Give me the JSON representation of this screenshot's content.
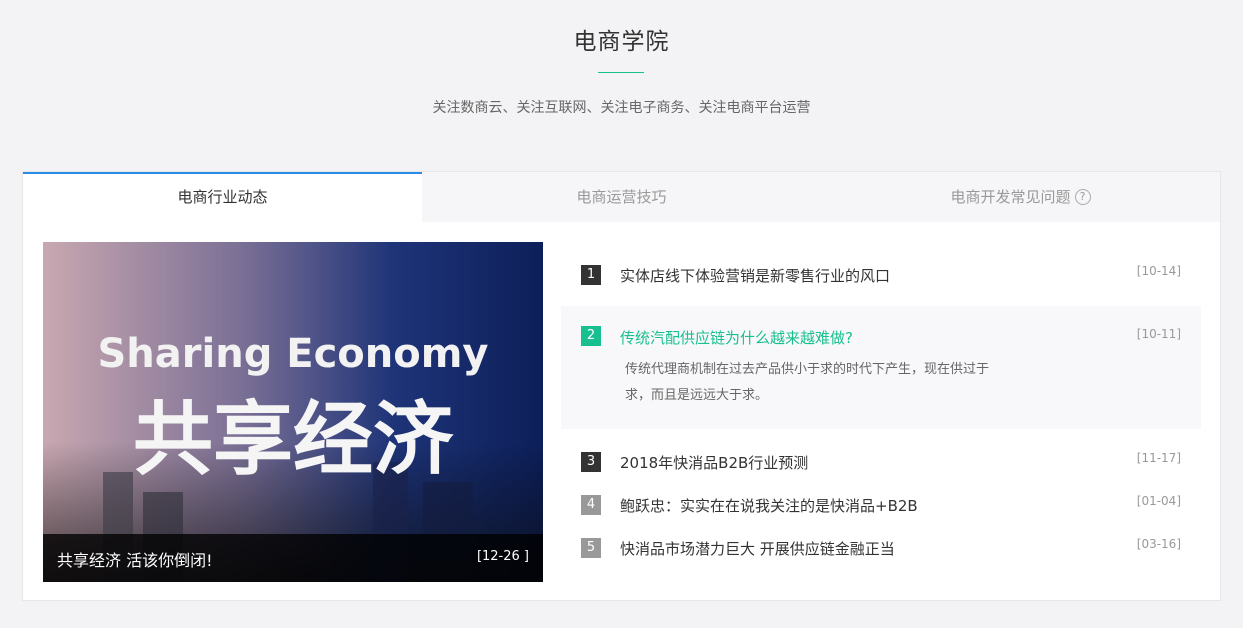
{
  "header": {
    "title": "电商学院",
    "subtitle": "关注数商云、关注互联网、关注电子商务、关注电商平台运营"
  },
  "tabs": [
    {
      "label": "电商行业动态",
      "active": true
    },
    {
      "label": "电商运营技巧",
      "active": false
    },
    {
      "label": "电商开发常见问题",
      "active": false,
      "help_icon": "?"
    }
  ],
  "feature": {
    "image_text_en": "Sharing Economy",
    "image_text_cn": "共享经济",
    "caption": "共享经济 活该你倒闭!",
    "date": "[12-26 ]"
  },
  "news": [
    {
      "num": "1",
      "title": "实体店线下体验营销是新零售行业的风口",
      "date": "[10-14]"
    },
    {
      "num": "2",
      "title": "传统汽配供应链为什么越来越难做?",
      "date": "[10-11]",
      "desc_line1": "传统代理商机制在过去产品供小于求的时代下产生，现在供过于",
      "desc_line2": "求，而且是远远大于求。"
    },
    {
      "num": "3",
      "title": "2018年快消品B2B行业预测",
      "date": "[11-17]"
    },
    {
      "num": "4",
      "title": "鲍跃忠：实实在在说我关注的是快消品+B2B",
      "date": "[01-04]"
    },
    {
      "num": "5",
      "title": "快消品市场潜力巨大 开展供应链金融正当",
      "date": "[03-16]"
    }
  ],
  "colors": {
    "accent": "#19c08f",
    "tab_active_border": "#2b8ce8"
  }
}
